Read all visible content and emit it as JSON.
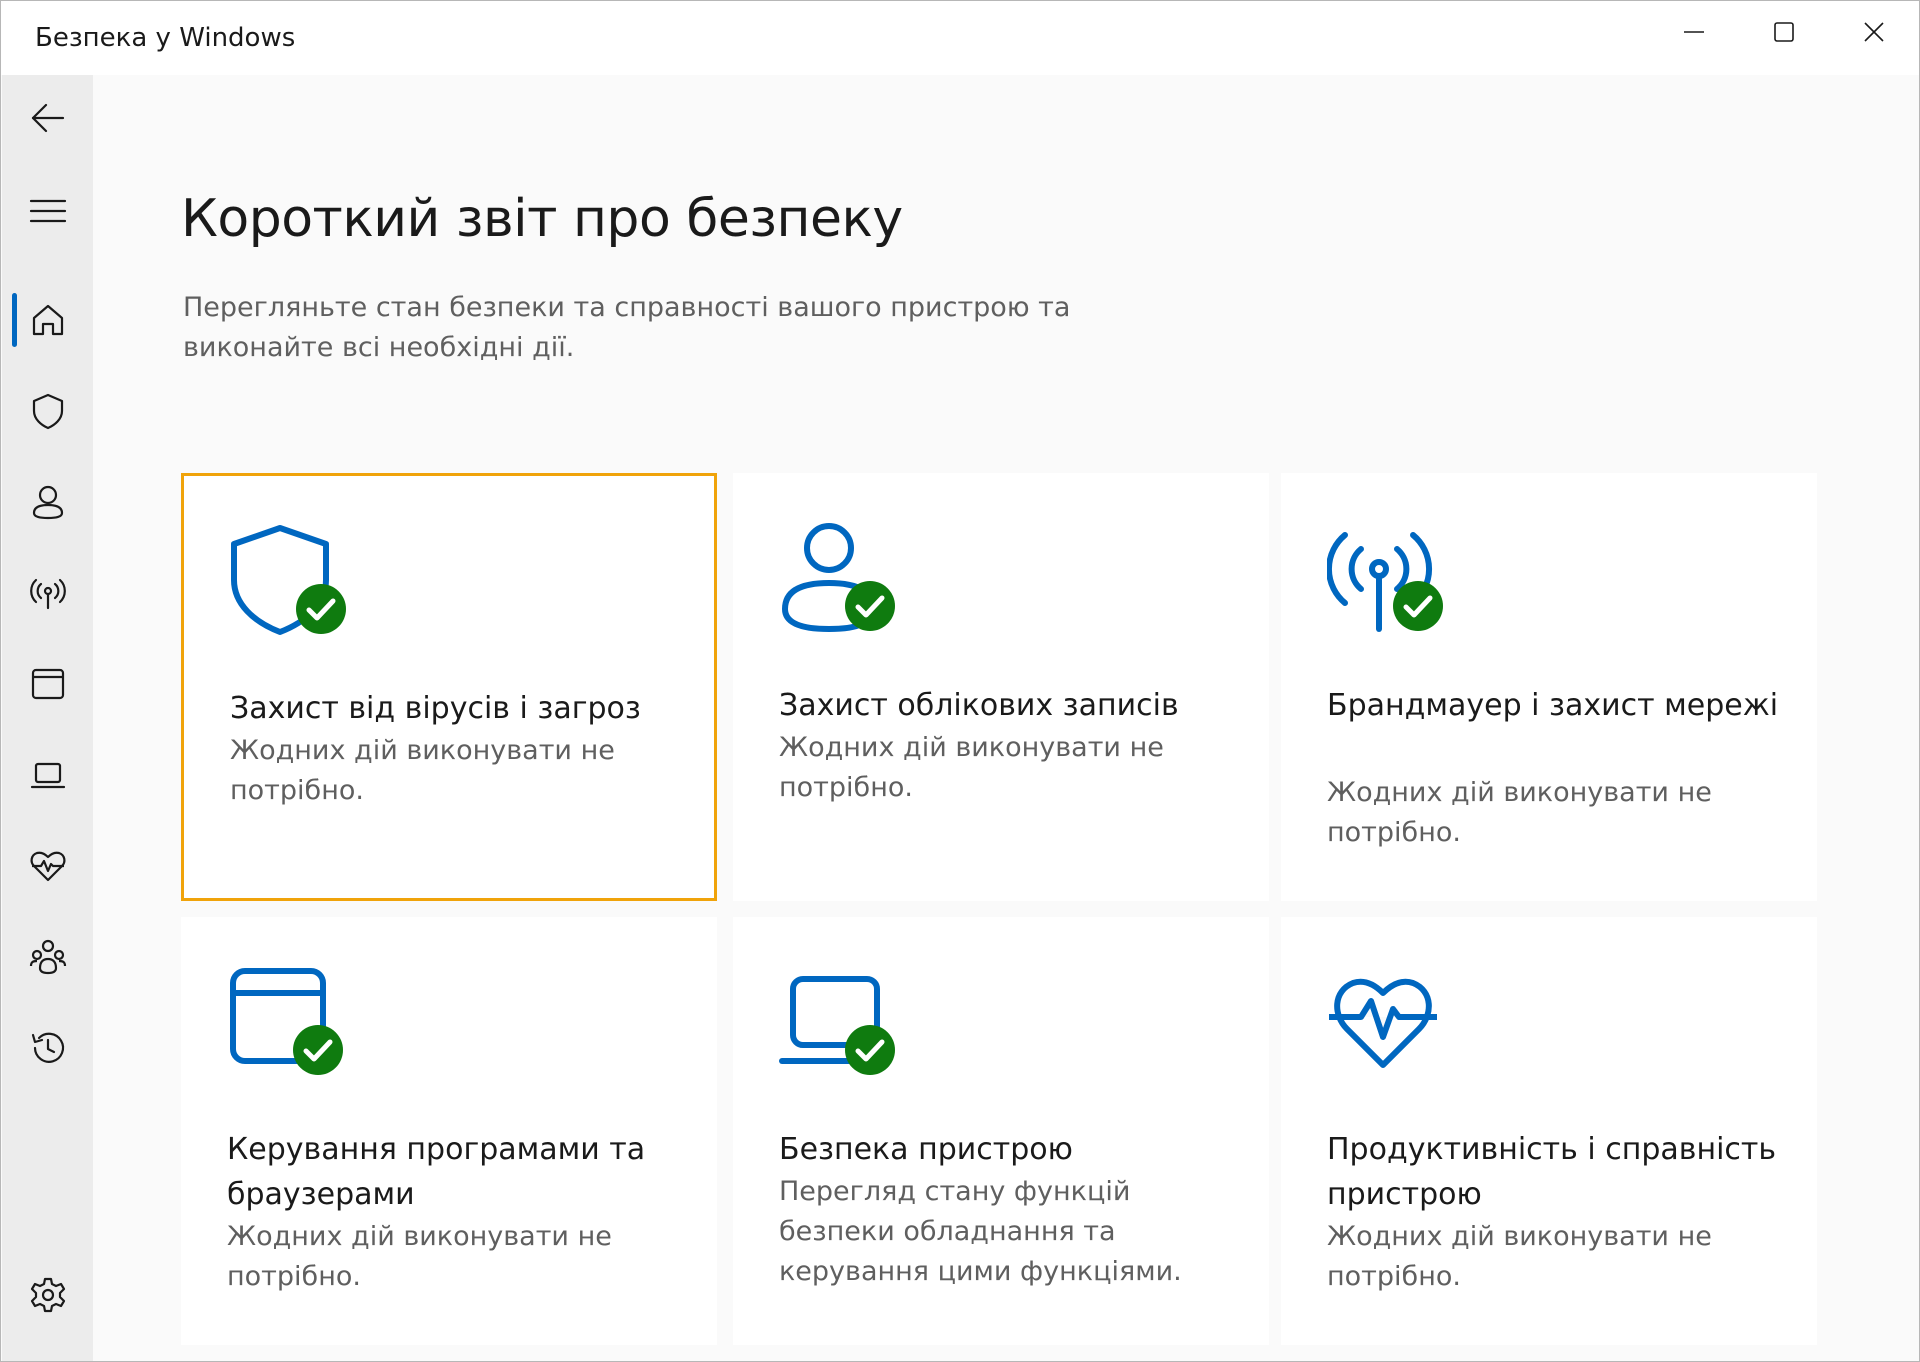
{
  "window": {
    "title": "Безпека у Windows"
  },
  "nav": {
    "items": [
      {
        "icon": "back-arrow-icon"
      },
      {
        "icon": "hamburger-menu-icon"
      },
      {
        "icon": "home-icon",
        "selected": true
      },
      {
        "icon": "shield-icon"
      },
      {
        "icon": "person-icon"
      },
      {
        "icon": "wireless-antenna-icon"
      },
      {
        "icon": "app-window-icon"
      },
      {
        "icon": "laptop-icon"
      },
      {
        "icon": "heart-pulse-icon"
      },
      {
        "icon": "family-icon"
      },
      {
        "icon": "history-icon"
      },
      {
        "icon": "settings-gear-icon"
      }
    ]
  },
  "page": {
    "title": "Короткий звіт про безпеку",
    "subtitle": "Перегляньте стан безпеки та справності вашого пристрою та виконайте всі необхідні дії."
  },
  "cards": [
    {
      "title": "Захист від вірусів і загроз",
      "description": "Жодних дій виконувати не потрібно.",
      "icon": "shield-icon",
      "status": "ok"
    },
    {
      "title": "Захист облікових записів",
      "description": "Жодних дій виконувати не потрібно.",
      "icon": "person-icon",
      "status": "ok"
    },
    {
      "title": "Брандмауер і захист мережі",
      "description": "Жодних дій виконувати не потрібно.",
      "icon": "wireless-antenna-icon",
      "status": "ok"
    },
    {
      "title": "Керування програмами та браузерами",
      "description": "Жодних дій виконувати не потрібно.",
      "icon": "app-window-icon",
      "status": "ok"
    },
    {
      "title": "Безпека пристрою",
      "description": "Перегляд стану функцій безпеки обладнання та керування цими функціями.",
      "icon": "laptop-icon",
      "status": "ok"
    },
    {
      "title": "Продуктивність і справність пристрою",
      "description": "Жодних дій виконувати не потрібно.",
      "icon": "heart-pulse-icon",
      "status": "none"
    }
  ],
  "colors": {
    "accent": "#0067c0",
    "ok_green": "#0f7b0f",
    "focus_outline": "#f0a30a"
  }
}
